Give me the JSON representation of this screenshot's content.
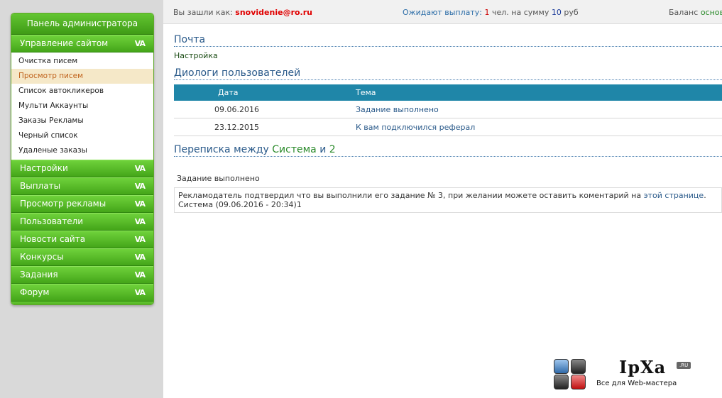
{
  "sidebar": {
    "title": "Панель администратора",
    "sections": [
      {
        "label": "Управление сайтом",
        "expanded": true,
        "items": [
          "Очистка писем",
          "Просмотр писем",
          "Список автокликеров",
          "Мульти Аккаунты",
          "Заказы Рекламы",
          "Черный список",
          "Удаленые заказы"
        ],
        "active_item": "Просмотр писем"
      },
      {
        "label": "Настройки"
      },
      {
        "label": "Выплаты"
      },
      {
        "label": "Просмотр рекламы"
      },
      {
        "label": "Пользователи"
      },
      {
        "label": "Новости сайта"
      },
      {
        "label": "Конкурсы"
      },
      {
        "label": "Задания"
      },
      {
        "label": "Форум"
      }
    ],
    "chevron": "VA"
  },
  "topbar": {
    "login_label": "Вы зашли как:",
    "login_user": "snovidenie@ro.ru",
    "pending_label": "Ожидают выплату:",
    "pending_count": "1",
    "pending_mid": "чел. на сумму",
    "pending_sum": "10",
    "pending_currency": "руб",
    "balance_label": "Баланс",
    "balance_value": "основно"
  },
  "main": {
    "mail_heading": "Почта",
    "settings_link": "Настройка",
    "dialogs_heading": "Диологи пользователей",
    "table_headers": {
      "date": "Дата",
      "topic": "Тема"
    },
    "rows": [
      {
        "date": "09.06.2016",
        "topic": "Задание выполнено"
      },
      {
        "date": "23.12.2015",
        "topic": "К вам подключился реферал"
      }
    ],
    "conversation": {
      "prefix": "Переписка между",
      "party1": "Система",
      "conj": "и",
      "party2": "2"
    },
    "message": {
      "title": "Задание выполнено",
      "body": "Рекламодатель подтвердил что вы выполнили его задание № 3, при желании можете оставить коментарий на",
      "link": "этой странице",
      "after_link": ".",
      "footer": "Система (09.06.2016 - 20:34)1"
    }
  },
  "watermark": {
    "brand": "IpXa",
    "badge": ".RU",
    "tagline": "Все для Web-мастера"
  },
  "colors": {
    "green": "#44a519",
    "header_blue": "#1f86a8",
    "link_blue": "#2a5a8a",
    "active_bg": "#f5e8c8"
  }
}
